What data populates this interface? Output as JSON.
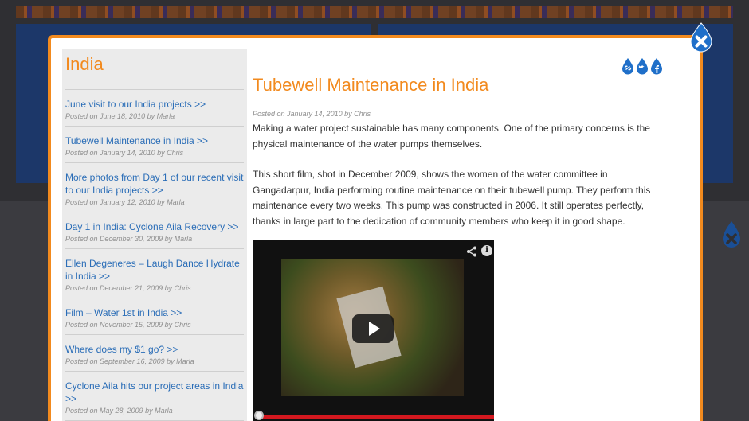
{
  "colors": {
    "accent": "#f28a1e",
    "link": "#2a6db7",
    "drop_blue": "#1f6fc9"
  },
  "sidebar": {
    "title": "India",
    "items": [
      {
        "title": "June visit to our India projects >>",
        "meta": "Posted on June 18, 2010 by Marla"
      },
      {
        "title": "Tubewell Maintenance in India >>",
        "meta": "Posted on January 14, 2010 by Chris"
      },
      {
        "title": "More photos from Day 1 of our recent visit to our India projects >>",
        "meta": "Posted on January 12, 2010 by Marla"
      },
      {
        "title": "Day 1 in India: Cyclone Aila Recovery >>",
        "meta": "Posted on December 30, 2009 by Marla"
      },
      {
        "title": "Ellen Degeneres – Laugh Dance Hydrate in India >>",
        "meta": "Posted on December 21, 2009 by Chris"
      },
      {
        "title": "Film – Water 1st in India >>",
        "meta": "Posted on November 15, 2009 by Chris"
      },
      {
        "title": "Where does my $1 go? >>",
        "meta": "Posted on September 16, 2009 by Marla"
      },
      {
        "title": "Cyclone Aila hits our project areas in India >>",
        "meta": "Posted on May 28, 2009 by Marla"
      }
    ]
  },
  "post": {
    "title": "Tubewell Maintenance in India",
    "meta": "Posted on January 14, 2010 by Chris",
    "p1": "Making a water project sustainable has many components. One of the primary concerns is the physical maintenance of the water pumps themselves.",
    "p2": "This short film, shot in December 2009, shows the women of the water committee in Gangadarpur, India performing routine maintenance on their tubewell pump. They perform this maintenance every two weeks. This pump was constructed in 2006. It still operates perfectly, thanks in large part to the dedication of community members who keep it in good shape."
  },
  "video": {
    "info_label": "i"
  },
  "icons": {
    "close": "close-drop-icon",
    "share_link": "link-drop-icon",
    "twitter": "twitter-drop-icon",
    "facebook": "facebook-drop-icon",
    "play": "play-icon",
    "share": "share-icon",
    "info": "info-icon"
  }
}
